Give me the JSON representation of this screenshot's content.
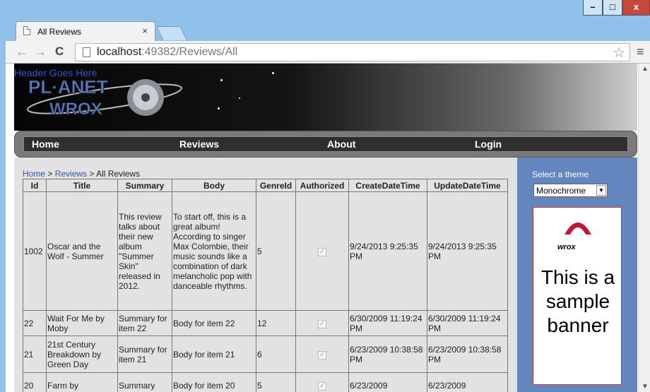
{
  "browser": {
    "tab_title": "All Reviews",
    "tab_close": "×",
    "url_host": "localhost",
    "url_rest": ":49382/Reviews/All"
  },
  "header": {
    "text": "Header Goes Here"
  },
  "menu": {
    "items": [
      "Home",
      "Reviews",
      "About",
      "Login"
    ]
  },
  "breadcrumb": {
    "home": "Home",
    "sep1": " > ",
    "reviews": "Reviews",
    "sep2": " > ",
    "current": "All Reviews"
  },
  "table": {
    "columns": [
      "Id",
      "Title",
      "Summary",
      "Body",
      "GenreId",
      "Authorized",
      "CreateDateTime",
      "UpdateDateTime"
    ],
    "rows": [
      {
        "id": "1002",
        "title": "Oscar and the Wolf - Summer",
        "summary": "This review talks about their new album \"Summer Skin\" released in 2012.",
        "body": "To start off, this is a great album! According to singer Max Colombie, their music sounds like a combination of dark melancholic pop with danceable rhythms.",
        "genre": "5",
        "authorized": true,
        "created": "9/24/2013 9:25:35 PM",
        "updated": "9/24/2013 9:25:35 PM"
      },
      {
        "id": "22",
        "title": "Wait For Me by Moby",
        "summary": "Summary for item 22",
        "body": "Body for item 22",
        "genre": "12",
        "authorized": true,
        "created": "6/30/2009 11:19:24 PM",
        "updated": "6/30/2009 11:19:24 PM"
      },
      {
        "id": "21",
        "title": "21st Century Breakdown by Green Day",
        "summary": "Summary for item 21",
        "body": "Body for item 21",
        "genre": "6",
        "authorized": true,
        "created": "6/23/2009 10:38:58 PM",
        "updated": "6/23/2009 10:38:58 PM"
      },
      {
        "id": "20",
        "title": "Farm by",
        "summary": "Summary",
        "body": "Body for item 20",
        "genre": "5",
        "authorized": true,
        "created": "6/23/2009",
        "updated": "6/23/2009"
      }
    ]
  },
  "sidebar": {
    "theme_label": "Select a theme",
    "theme_value": "Monochrome",
    "banner_brand": "wrox",
    "banner_text": "This is a sample banner"
  }
}
